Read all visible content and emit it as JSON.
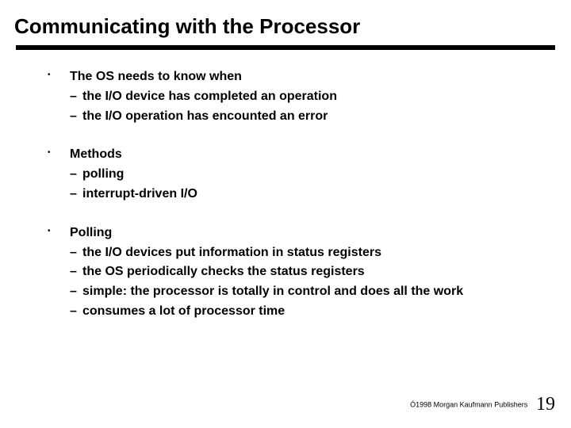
{
  "title": "Communicating with the Processor",
  "sections": [
    {
      "head": "The OS needs to know when",
      "items": [
        "the I/O device has completed an operation",
        "the I/O operation has encounted an error"
      ]
    },
    {
      "head": "Methods",
      "items": [
        "polling",
        "interrupt-driven I/O"
      ]
    },
    {
      "head": "Polling",
      "items": [
        "the I/O devices put information in status registers",
        "the OS periodically checks the status registers",
        "simple: the processor is totally in control and does all the work",
        "consumes a lot of processor time"
      ]
    }
  ],
  "footer": {
    "copyright": "Ó1998 Morgan Kaufmann Publishers",
    "page": "19"
  }
}
